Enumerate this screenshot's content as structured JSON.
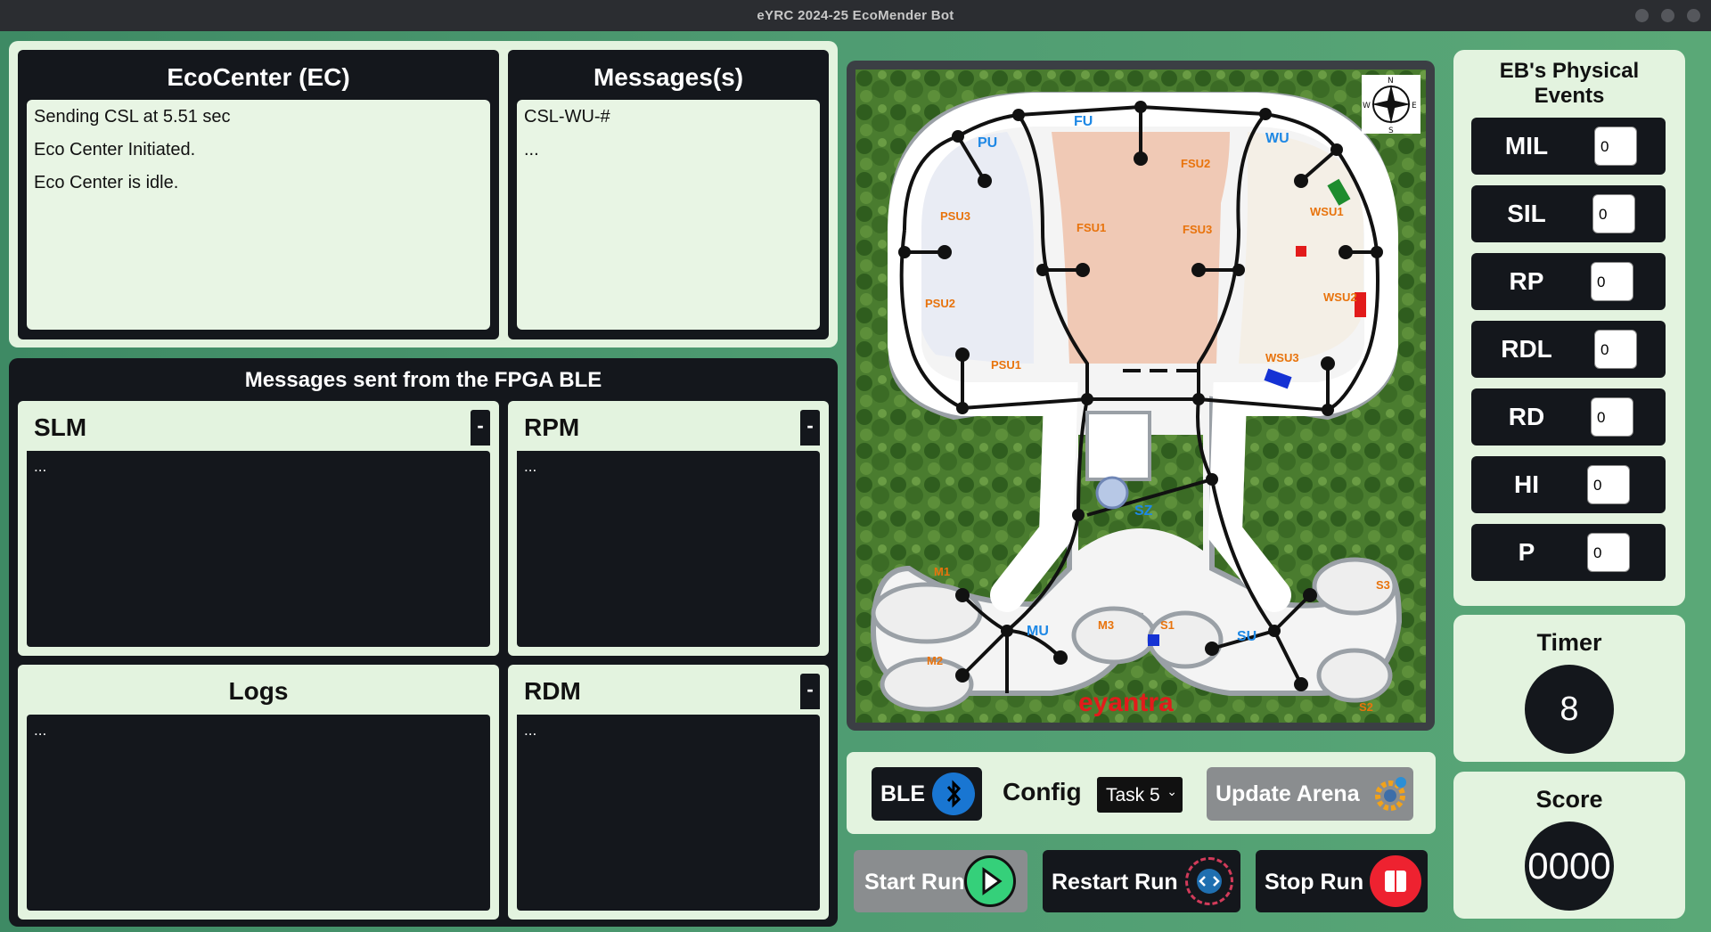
{
  "window": {
    "title": "eYRC 2024-25 EcoMender Bot"
  },
  "ecocenter": {
    "title": "EcoCenter (EC)",
    "lines": [
      "Sending CSL at 5.51 sec",
      "Eco Center Initiated.",
      "Eco Center is idle."
    ]
  },
  "messages": {
    "title": "Messages(s)",
    "lines": [
      "CSL-WU-#",
      "..."
    ]
  },
  "fpga": {
    "title": "Messages sent from the FPGA BLE",
    "slm": {
      "label": "SLM",
      "minus": "-",
      "content": "..."
    },
    "rpm": {
      "label": "RPM",
      "minus": "-",
      "content": "..."
    },
    "logs": {
      "label": "Logs",
      "content": "..."
    },
    "rdm": {
      "label": "RDM",
      "minus": "-",
      "content": "..."
    }
  },
  "arena": {
    "zones": [
      "PU",
      "FU",
      "WU",
      "MU",
      "SU",
      "SZ"
    ],
    "units": [
      "PSU1",
      "PSU2",
      "PSU3",
      "FSU1",
      "FSU2",
      "FSU3",
      "WSU1",
      "WSU2",
      "WSU3",
      "M1",
      "M2",
      "M3",
      "S1",
      "S2",
      "S3"
    ],
    "compass": [
      "N",
      "S",
      "E",
      "W"
    ],
    "logo": "eyantra",
    "zone_color": "#1e88e5",
    "unit_color": "#e8730c"
  },
  "events": {
    "title": "EB's Physical Events",
    "items": [
      {
        "label": "MIL",
        "value": "0"
      },
      {
        "label": "SIL",
        "value": "0"
      },
      {
        "label": "RP",
        "value": "0"
      },
      {
        "label": "RDL",
        "value": "0"
      },
      {
        "label": "RD",
        "value": "0"
      },
      {
        "label": "HI",
        "value": "0"
      },
      {
        "label": "P",
        "value": "0"
      }
    ]
  },
  "timer": {
    "title": "Timer",
    "value": "8"
  },
  "score": {
    "title": "Score",
    "value": "0000"
  },
  "controls": {
    "ble_label": "BLE",
    "config_label": "Config",
    "task_selected": "Task 5",
    "update_label": "Update Arena",
    "start_label": "Start Run",
    "restart_label": "Restart Run",
    "stop_label": "Stop Run"
  }
}
